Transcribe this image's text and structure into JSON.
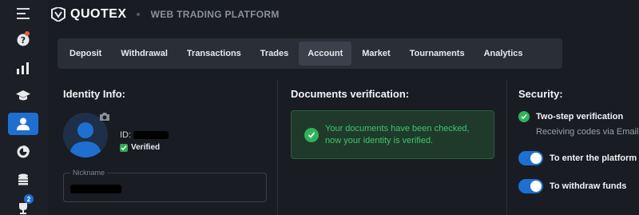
{
  "header": {
    "brand": "QUOTEX",
    "subtitle": "WEB TRADING PLATFORM"
  },
  "rail": {
    "items": [
      {
        "icon": "menu-icon"
      },
      {
        "icon": "help-icon",
        "has_dot": true
      },
      {
        "icon": "chart-bars-icon"
      },
      {
        "icon": "graduation-cap-icon"
      },
      {
        "icon": "user-icon",
        "active": true
      },
      {
        "icon": "pie-chart-icon"
      },
      {
        "icon": "coins-icon"
      },
      {
        "icon": "trophy-icon",
        "badge": "2"
      }
    ]
  },
  "tabs": [
    {
      "label": "Deposit"
    },
    {
      "label": "Withdrawal"
    },
    {
      "label": "Transactions"
    },
    {
      "label": "Trades"
    },
    {
      "label": "Account",
      "active": true
    },
    {
      "label": "Market"
    },
    {
      "label": "Tournaments"
    },
    {
      "label": "Analytics"
    }
  ],
  "identity": {
    "title": "Identity Info:",
    "id_prefix": "ID:",
    "verified_label": "Verified",
    "nickname_label": "Nickname"
  },
  "documents": {
    "title": "Documents verification:",
    "message": "Your documents have been checked, now your identity is verified."
  },
  "security": {
    "title": "Security:",
    "two_step_title": "Two-step verification",
    "two_step_sub": "Receiving codes via Email",
    "toggle_platform_label": "To enter the platform",
    "toggle_platform_on": true,
    "toggle_withdraw_label": "To withdraw funds",
    "toggle_withdraw_on": true
  },
  "colors": {
    "accent": "#1f6fd1",
    "success": "#2fb35a",
    "background": "#191c23"
  }
}
